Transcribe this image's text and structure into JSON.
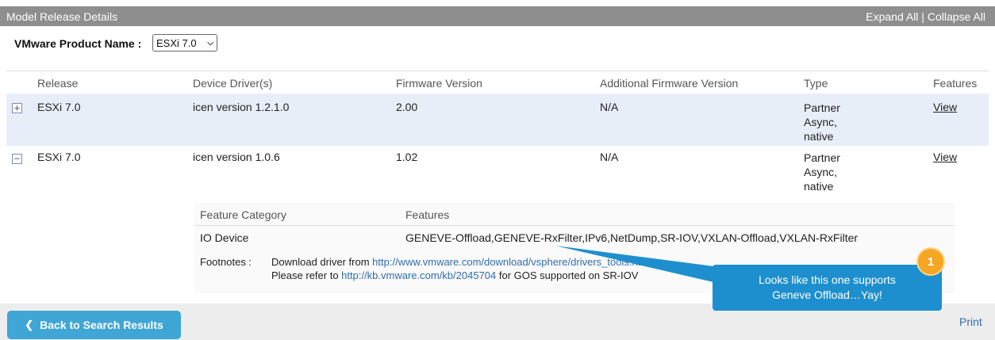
{
  "header": {
    "title": "Model Release Details",
    "expand_all": "Expand All",
    "separator": " | ",
    "collapse_all": "Collapse All"
  },
  "product": {
    "label": "VMware Product Name :",
    "selected": "ESXi 7.0"
  },
  "table": {
    "columns": [
      "Release",
      "Device Driver(s)",
      "Firmware Version",
      "Additional Firmware Version",
      "Type",
      "Features"
    ],
    "rows": [
      {
        "toggle": "+",
        "release": "ESXi 7.0",
        "driver": "icen version 1.2.1.0",
        "firmware": "2.00",
        "additional_firmware": "N/A",
        "type_lines": [
          "Partner",
          "Async,",
          "native"
        ],
        "features_link": "View"
      },
      {
        "toggle": "−",
        "release": "ESXi 7.0",
        "driver": "icen version 1.0.6",
        "firmware": "1.02",
        "additional_firmware": "N/A",
        "type_lines": [
          "Partner",
          "Async,",
          "native"
        ],
        "features_link": "View"
      }
    ]
  },
  "feature_detail": {
    "columns": [
      "Feature Category",
      "Features"
    ],
    "category": "IO Device",
    "features": "GENEVE-Offload,GENEVE-RxFilter,IPv6,NetDump,SR-IOV,VXLAN-Offload,VXLAN-RxFilter",
    "footnotes_label": "Footnotes  :",
    "footnote1_prefix": "Download driver from ",
    "footnote1_link": "http://www.vmware.com/download/vsphere/drivers_tools.html",
    "footnote2_prefix": "Please refer to ",
    "footnote2_link": "http://kb.vmware.com/kb/2045704",
    "footnote2_suffix": " for GOS supported on SR-IOV"
  },
  "callout": {
    "badge": "1",
    "line1": "Looks like this one supports",
    "line2": "Geneve Offload…Yay!"
  },
  "footer": {
    "back_label": "Back to Search Results",
    "print_label": "Print"
  },
  "colors": {
    "header_bg": "#8e8e8e",
    "row_highlight": "#e8eef7",
    "link_blue": "#2f6db1",
    "button_blue": "#3fa6d6",
    "callout_blue": "#1e8fce",
    "badge_orange": "#f5a623"
  }
}
